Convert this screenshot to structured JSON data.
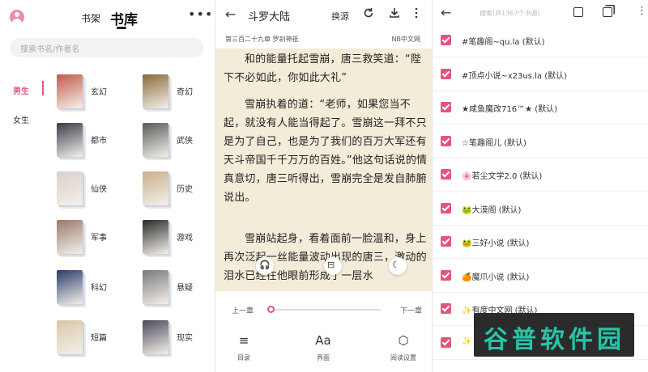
{
  "library": {
    "tab_shelf": "书架",
    "tab_library": "书库",
    "more": "•••",
    "search_placeholder": "搜索书名/作者名",
    "genders": [
      "男生",
      "女生"
    ],
    "categories": [
      {
        "label": "玄幻",
        "color": "#c35a4a"
      },
      {
        "label": "奇幻",
        "color": "#8a6a3a"
      },
      {
        "label": "都市",
        "color": "#3a3a46"
      },
      {
        "label": "武侠",
        "color": "#5a5a5a"
      },
      {
        "label": "仙侠",
        "color": "#d8d0cc"
      },
      {
        "label": "历史",
        "color": "#c7b08a"
      },
      {
        "label": "军事",
        "color": "#9a7a6a"
      },
      {
        "label": "游戏",
        "color": "#2a2a2a"
      },
      {
        "label": "科幻",
        "color": "#2a3a6a"
      },
      {
        "label": "悬疑",
        "color": "#7a7a7a"
      },
      {
        "label": "短篇",
        "color": "#d8c8a8"
      },
      {
        "label": "现实",
        "color": "#4a4a5a"
      }
    ]
  },
  "reader": {
    "book_title": "斗罗大陆",
    "change_source": "换源",
    "chapter": "第三百二十九章 罗刹神祇",
    "source_name": "NB中文网",
    "paragraphs": [
      "和的能量托起雪崩，唐三救笑道：“陛下不必如此，你如此大礼”",
      "雪崩执着的道：“老师，如果您当不起，就没有人能当得起了。雪崩这一拜不只是为了自己，也是为了我们的百万大军还有天斗帝国千千万万的百姓。”他这句话说的情真意切，唐三听得出，雪崩完全是发自肺腑说出。",
      "雪崩站起身，看着面前一脸温和，身上再次泛起一丝能量波动出现的唐三，激动的泪水已经在他眼前形成了一层水"
    ],
    "prev_chapter": "上一章",
    "next_chapter": "下一章",
    "progress": 0.02,
    "nav": [
      {
        "icon": "≡",
        "label": "目录"
      },
      {
        "icon": "Aa",
        "label": "界面"
      },
      {
        "icon": "⬡",
        "label": "阅读设置"
      }
    ]
  },
  "sources": {
    "search_placeholder": "搜索(共1367个书源)",
    "accent": "#e4557a",
    "items": [
      "#笔趣阁~qu.la (默认)",
      "#顶点小说~x23us.la (默认)",
      "★咸鱼魔改716™★ (默认)",
      "☆笔趣阁儿 (默认)",
      "🌸若尘文学2.0 (默认)",
      "🐸大漠阁 (默认)",
      "🐸三好小说 (默认)",
      "🍊魔爪小说 (默认)",
      "✨有度中文网 (默认)",
      "✨"
    ]
  },
  "watermark": "谷普软件园"
}
